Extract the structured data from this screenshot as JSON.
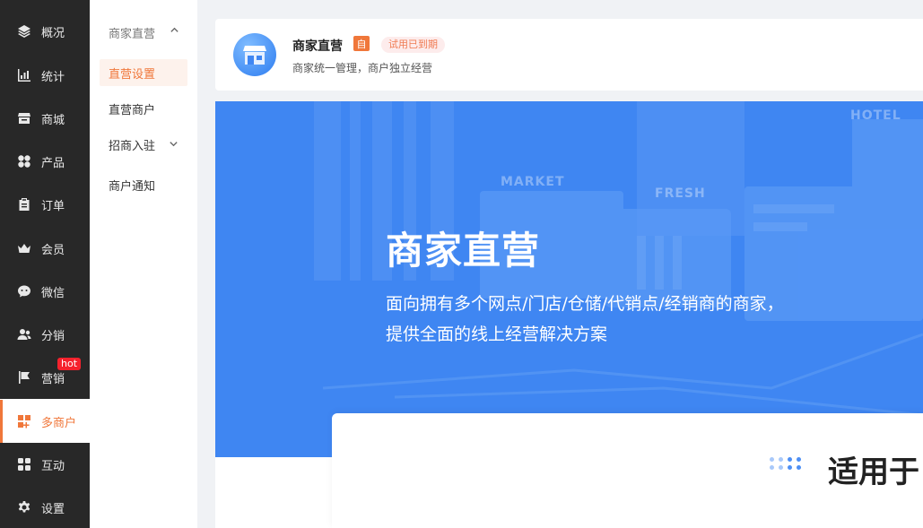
{
  "sidebar": {
    "items": [
      {
        "label": "概况",
        "icon": "layers-icon"
      },
      {
        "label": "统计",
        "icon": "chart-icon"
      },
      {
        "label": "商城",
        "icon": "shop-icon"
      },
      {
        "label": "产品",
        "icon": "grid-icon"
      },
      {
        "label": "订单",
        "icon": "clipboard-icon"
      },
      {
        "label": "会员",
        "icon": "crown-icon"
      },
      {
        "label": "微信",
        "icon": "wechat-icon"
      },
      {
        "label": "分销",
        "icon": "users-icon"
      },
      {
        "label": "营销",
        "icon": "flag-icon",
        "badge": "hot"
      },
      {
        "label": "多商户",
        "icon": "merchant-icon",
        "active": true
      },
      {
        "label": "互动",
        "icon": "apps-icon"
      },
      {
        "label": "设置",
        "icon": "gear-icon"
      }
    ]
  },
  "submenu": {
    "group_title": "商家直营",
    "items": [
      {
        "label": "直营设置",
        "active": true
      },
      {
        "label": "直营商户"
      },
      {
        "label": "招商入驻",
        "expandable": true
      },
      {
        "label": "商户通知"
      }
    ]
  },
  "header": {
    "title": "商家直营",
    "self_badge": "自",
    "status_badge": "试用已到期",
    "subtitle": "商家统一管理，商户独立经营"
  },
  "banner": {
    "title": "商家直营",
    "description": "面向拥有多个网点/门店/仓储/代销点/经销商的商家，提供全面的线上经营解决方案",
    "signs": {
      "market": "MARKET",
      "fresh": "FRESH",
      "hotel": "HOTEL"
    }
  },
  "section": {
    "heading": "适用于"
  },
  "colors": {
    "accent": "#f0773a",
    "sidebar_bg": "#282828",
    "banner_bg": "#3f86f2",
    "hot_badge": "#f5222d"
  }
}
